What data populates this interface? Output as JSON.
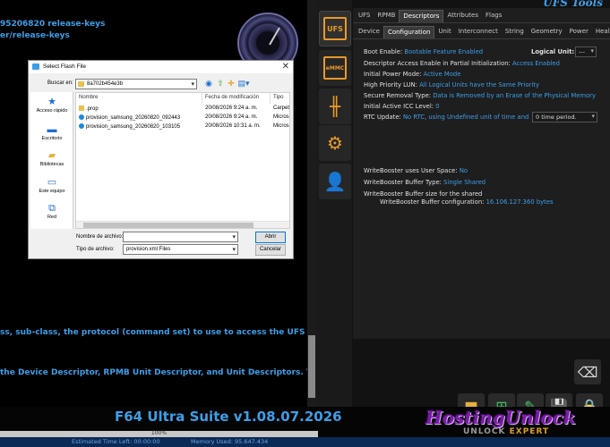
{
  "log": {
    "lines": [
      "95206820 release-keys",
      "er/release-keys",
      "ss, sub-class, the protocol (command set) to use to access the UFS device and the",
      "the Device Descriptor, RPMB Unit Descriptor, and Unit Descriptors. The Configura"
    ]
  },
  "footer": {
    "title": "F64 Ultra Suite v1.08.07.2026",
    "progress_label": "100%",
    "progress_percent": 100,
    "estimated_label": "Estimated Time Left: 00:00:00",
    "memory_label": "Memory Used: 95.647.434",
    "brand": "HostingUnlock",
    "brand_sub_a": "UNLOCK",
    "brand_sub_b": "EXPERT"
  },
  "right": {
    "title": "UFS Tools",
    "tool_buttons": [
      {
        "label": "UFS",
        "icon": "ufs-chip-icon"
      },
      {
        "label": "eMMC",
        "icon": "emmc-chip-icon"
      },
      {
        "label": "",
        "icon": "chip-pins-icon"
      },
      {
        "label": "",
        "icon": "gear-chip-icon"
      },
      {
        "label": "",
        "icon": "user-icon"
      }
    ],
    "tabs_top": [
      "UFS",
      "RPMB",
      "Descriptors",
      "Attributes",
      "Flags"
    ],
    "tabs_top_active": "Descriptors",
    "tabs_sub": [
      "Device",
      "Configuration",
      "Unit",
      "Interconnect",
      "String",
      "Geometry",
      "Power",
      "Health"
    ],
    "tabs_sub_active": "Configuration",
    "props": [
      {
        "label": "Boot Enable:",
        "value": "Bootable Feature Enabled"
      },
      {
        "label": "Descriptor Access Enable in Partial Initialization:",
        "value": "Access Enabled"
      },
      {
        "label": "Initial Power Mode:",
        "value": "Active Mode"
      },
      {
        "label": "High Priority LUN:",
        "value": "All Logical Units have the Same Priority"
      },
      {
        "label": "Secure Removal Type:",
        "value": "Data is Removed by an Erase of the Physical Memory"
      },
      {
        "label": "Initial Active ICC Level:",
        "value": "0"
      },
      {
        "label": "RTC Update:",
        "value": "No RTC, using Undefined unit of time and"
      }
    ],
    "logical_unit_label": "Logical Unit:",
    "logical_unit_value": "---",
    "rtc_combo_value": "0 time period.",
    "wb": [
      {
        "label": "WriteBooster uses User Space:",
        "value": "No"
      },
      {
        "label": "WriteBooster Buffer Type:",
        "value": "Single Shared"
      },
      {
        "label": "WriteBooster Buffer size for the shared",
        "value": ""
      },
      {
        "label": "WriteBooster Buffer configuration:",
        "value": "16.106.127.360 bytes"
      }
    ]
  },
  "dialog": {
    "title": "Select Flash File",
    "lookin_label": "Buscar en:",
    "lookin_value": "8a702b454e3b",
    "places": [
      "Acceso rápido",
      "Escritorio",
      "Bibliotecas",
      "Este equipo",
      "Red"
    ],
    "columns": [
      "Nombre",
      "Fecha de modificación",
      "Tipo"
    ],
    "files": [
      {
        "name": ".prop",
        "date": "20/08/2026 9:24 a. m.",
        "type": "Carpet",
        "icon": "folder-icon"
      },
      {
        "name": "provision_samsung_20260820_092443",
        "date": "20/08/2026 9:24 a. m.",
        "type": "Micros",
        "icon": "edge-file-icon"
      },
      {
        "name": "provision_samsung_20260820_103105",
        "date": "20/08/2026 10:31 a. m.",
        "type": "Micros",
        "icon": "edge-file-icon"
      }
    ],
    "filename_label": "Nombre de archivo:",
    "filename_value": "",
    "filetype_label": "Tipo de archivo:",
    "filetype_value": "provision.xml Files",
    "open_label": "Abrir",
    "cancel_label": "Cancelar"
  },
  "colors": {
    "accent_blue": "#3d9ee8",
    "orange": "#e89a2a",
    "brand_purple": "#7a1da8"
  }
}
